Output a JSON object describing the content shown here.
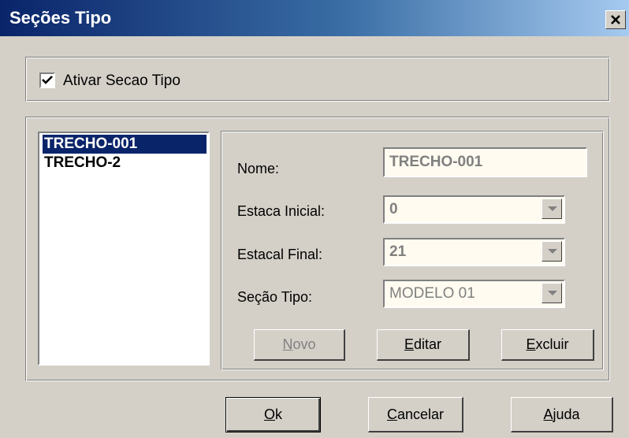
{
  "window": {
    "title": "Seções Tipo",
    "close_glyph": "✕",
    "close_icon": "close-icon"
  },
  "activate": {
    "label": "Ativar Secao Tipo",
    "checked": true
  },
  "list": {
    "items": [
      "TRECHO-001",
      "TRECHO-2"
    ],
    "selected_index": 0
  },
  "form": {
    "nome_label": "Nome:",
    "nome_value": "TRECHO-001",
    "estaca_inicial_label": "Estaca Inicial:",
    "estaca_inicial_value": "0",
    "estaca_final_label": "Estacal Final:",
    "estaca_final_value": "21",
    "secao_tipo_label": "Seção Tipo:",
    "secao_tipo_value": "MODELO 01"
  },
  "buttons": {
    "novo": {
      "label": "Novo",
      "mnemonic": "N",
      "rest": "ovo",
      "enabled": false
    },
    "editar": {
      "label": "Editar",
      "mnemonic": "E",
      "rest": "ditar"
    },
    "excluir": {
      "label": "Excluir",
      "mnemonic": "E",
      "rest": "xcluir"
    },
    "ok": {
      "label": "Ok",
      "mnemonic": "O",
      "rest": "k"
    },
    "cancelar": {
      "label": "Cancelar",
      "mnemonic": "C",
      "rest": "ancelar"
    },
    "ajuda": {
      "label": "Ajuda",
      "mnemonic": "A",
      "rest": "juda"
    }
  },
  "colors": {
    "title_gradient_start": "#0a246a",
    "title_gradient_end": "#a6caf0",
    "dialog_face": "#d4d0c8",
    "selection": "#0a246a",
    "disabled_field": "#fffbf0"
  }
}
